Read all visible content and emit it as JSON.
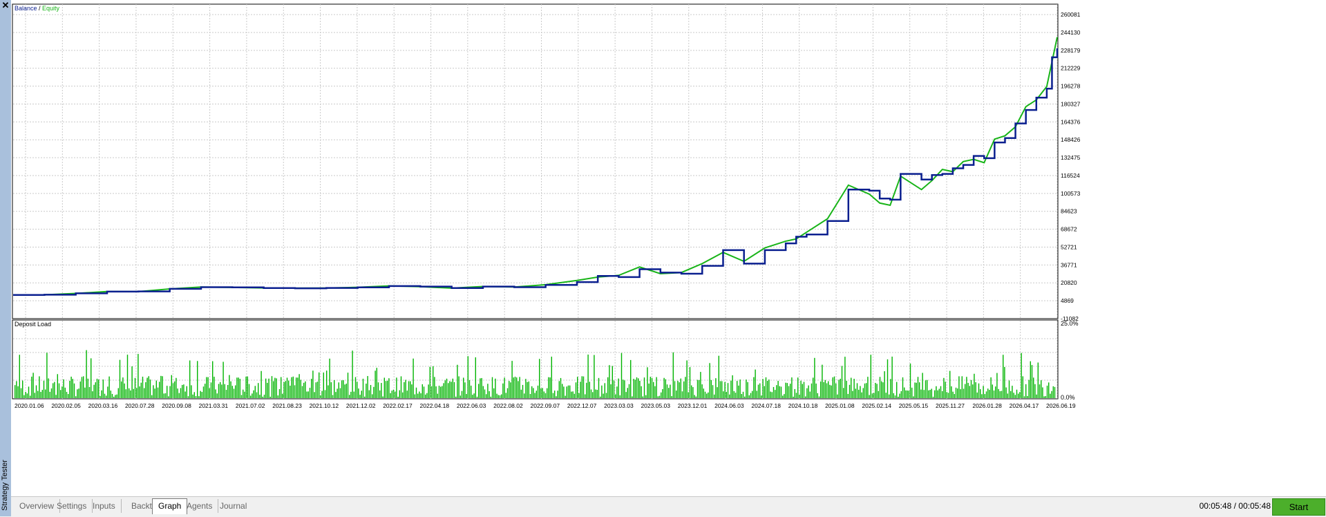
{
  "window": {
    "side_title": "Strategy Tester"
  },
  "top_chart": {
    "legend_balance": "Balance",
    "legend_sep": " / ",
    "legend_equity": "Equity",
    "balance_color": "#0a1f8f",
    "equity_color": "#18b418",
    "y_ticks": [
      "260081",
      "244130",
      "228179",
      "212229",
      "196278",
      "180327",
      "164376",
      "148426",
      "132475",
      "116524",
      "100573",
      "84623",
      "68672",
      "52721",
      "36771",
      "20820",
      "4869",
      "-11082"
    ]
  },
  "bottom_chart": {
    "label": "Deposit Load",
    "y_top": "25.0%",
    "y_bottom": "0.0%",
    "bar_color": "#00b400"
  },
  "x_ticks": [
    "2020.01.06",
    "2020.02.05",
    "2020.03.16",
    "2020.07.28",
    "2020.09.08",
    "2021.03.31",
    "2021.07.02",
    "2021.08.23",
    "2021.10.12",
    "2021.12.02",
    "2022.02.17",
    "2022.04.18",
    "2022.06.03",
    "2022.08.02",
    "2022.09.07",
    "2022.12.07",
    "2023.03.03",
    "2023.05.03",
    "2023.12.01",
    "2024.06.03",
    "2024.07.18",
    "2024.10.18",
    "2025.01.08",
    "2025.02.14",
    "2025.05.15",
    "2025.11.27",
    "2026.01.28",
    "2026.04.17",
    "2026.06.19"
  ],
  "chart_data": {
    "type": "line",
    "x_labels": [
      "2020.01.06",
      "2020.02.05",
      "2020.03.16",
      "2020.07.28",
      "2020.09.08",
      "2021.03.31",
      "2021.07.02",
      "2021.08.23",
      "2021.10.12",
      "2021.12.02",
      "2022.02.17",
      "2022.04.18",
      "2022.06.03",
      "2022.08.02",
      "2022.09.07",
      "2022.12.07",
      "2023.03.03",
      "2023.05.03",
      "2023.12.01",
      "2024.06.03",
      "2024.07.18",
      "2024.10.18",
      "2025.01.08",
      "2025.02.14",
      "2025.05.15",
      "2025.11.27",
      "2026.01.28",
      "2026.04.17",
      "2026.06.19"
    ],
    "ylim": [
      -11082,
      262000
    ],
    "series": [
      {
        "name": "Balance",
        "x": [
          0,
          0.03,
          0.06,
          0.09,
          0.12,
          0.15,
          0.18,
          0.21,
          0.24,
          0.27,
          0.3,
          0.33,
          0.36,
          0.39,
          0.42,
          0.45,
          0.48,
          0.51,
          0.54,
          0.56,
          0.58,
          0.6,
          0.62,
          0.64,
          0.66,
          0.68,
          0.7,
          0.72,
          0.74,
          0.75,
          0.76,
          0.78,
          0.8,
          0.82,
          0.83,
          0.84,
          0.85,
          0.87,
          0.88,
          0.89,
          0.9,
          0.91,
          0.92,
          0.93,
          0.94,
          0.95,
          0.96,
          0.97,
          0.98,
          0.99,
          0.995,
          1.0
        ],
        "y": [
          10000,
          10300,
          11500,
          13000,
          13200,
          15500,
          17000,
          16800,
          16200,
          16000,
          16300,
          16800,
          18000,
          17500,
          16200,
          17500,
          17000,
          19000,
          21500,
          27000,
          26000,
          33000,
          30000,
          29000,
          36000,
          50000,
          38000,
          50000,
          56000,
          62000,
          64000,
          76000,
          104000,
          103000,
          96000,
          95000,
          118000,
          113000,
          117000,
          118000,
          123000,
          126000,
          134000,
          132000,
          146000,
          150000,
          163000,
          175000,
          186000,
          194000,
          222000,
          230000
        ]
      },
      {
        "name": "Equity",
        "x": [
          0,
          0.03,
          0.06,
          0.09,
          0.12,
          0.15,
          0.18,
          0.21,
          0.24,
          0.27,
          0.3,
          0.33,
          0.36,
          0.39,
          0.42,
          0.45,
          0.48,
          0.51,
          0.54,
          0.56,
          0.58,
          0.6,
          0.62,
          0.64,
          0.66,
          0.68,
          0.7,
          0.72,
          0.74,
          0.75,
          0.76,
          0.78,
          0.8,
          0.82,
          0.83,
          0.84,
          0.85,
          0.87,
          0.88,
          0.89,
          0.9,
          0.91,
          0.92,
          0.93,
          0.94,
          0.95,
          0.96,
          0.97,
          0.98,
          0.99,
          0.995,
          1.0
        ],
        "y": [
          10000,
          10200,
          11400,
          13100,
          13000,
          15400,
          17100,
          16700,
          16300,
          16100,
          16200,
          16900,
          18100,
          17400,
          16100,
          17600,
          17100,
          19200,
          23000,
          26000,
          27500,
          35000,
          29000,
          30000,
          38000,
          48000,
          40000,
          52000,
          58000,
          60000,
          66000,
          78000,
          108000,
          100000,
          92000,
          90000,
          116000,
          104000,
          112000,
          122000,
          120000,
          129000,
          131000,
          128000,
          149000,
          152000,
          160000,
          178000,
          184000,
          196000,
          218000,
          240000
        ]
      }
    ]
  }
}
